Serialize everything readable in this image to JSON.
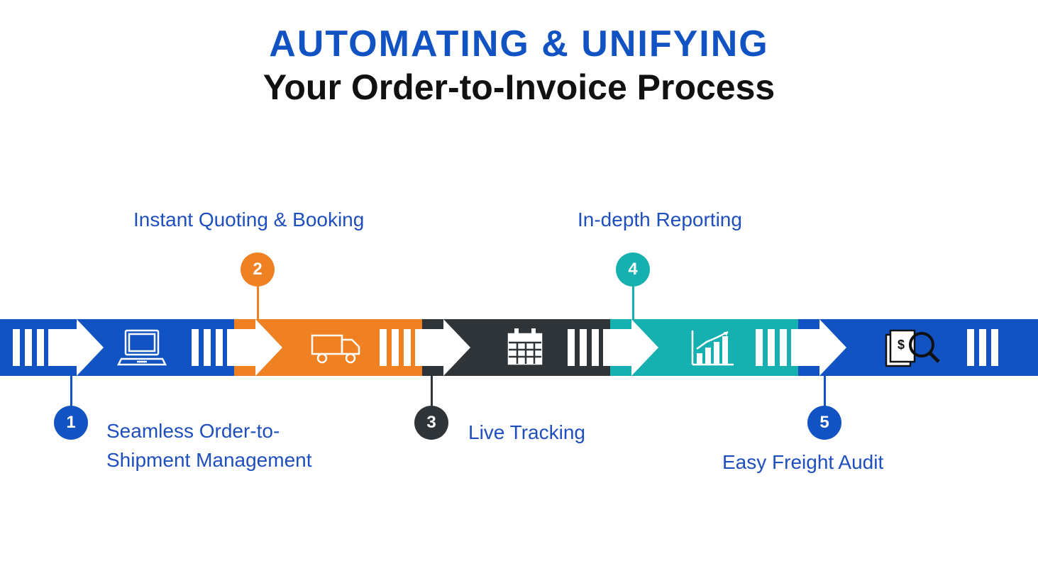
{
  "title_line1": "AUTOMATING & UNIFYING",
  "title_line2": "Your Order-to-Invoice Process",
  "colors": {
    "blue": "#1253c4",
    "orange": "#ef8122",
    "dark": "#2f3438",
    "teal": "#17b0b0"
  },
  "steps": [
    {
      "num": "1",
      "label": "Seamless Order-to-\nShipment Management",
      "badge_color": "#1253c4",
      "seg_color": "#1253c4",
      "position": "below"
    },
    {
      "num": "2",
      "label": "Instant Quoting & Booking",
      "badge_color": "#ef8122",
      "seg_color": "#ef8122",
      "position": "above"
    },
    {
      "num": "3",
      "label": "Live Tracking",
      "badge_color": "#2f3438",
      "seg_color": "#2f3438",
      "position": "below"
    },
    {
      "num": "4",
      "label": "In-depth Reporting",
      "badge_color": "#17b0b0",
      "seg_color": "#17b0b0",
      "position": "above"
    },
    {
      "num": "5",
      "label": "Easy Freight Audit",
      "badge_color": "#1253c4",
      "seg_color": "#1253c4",
      "position": "below"
    }
  ]
}
